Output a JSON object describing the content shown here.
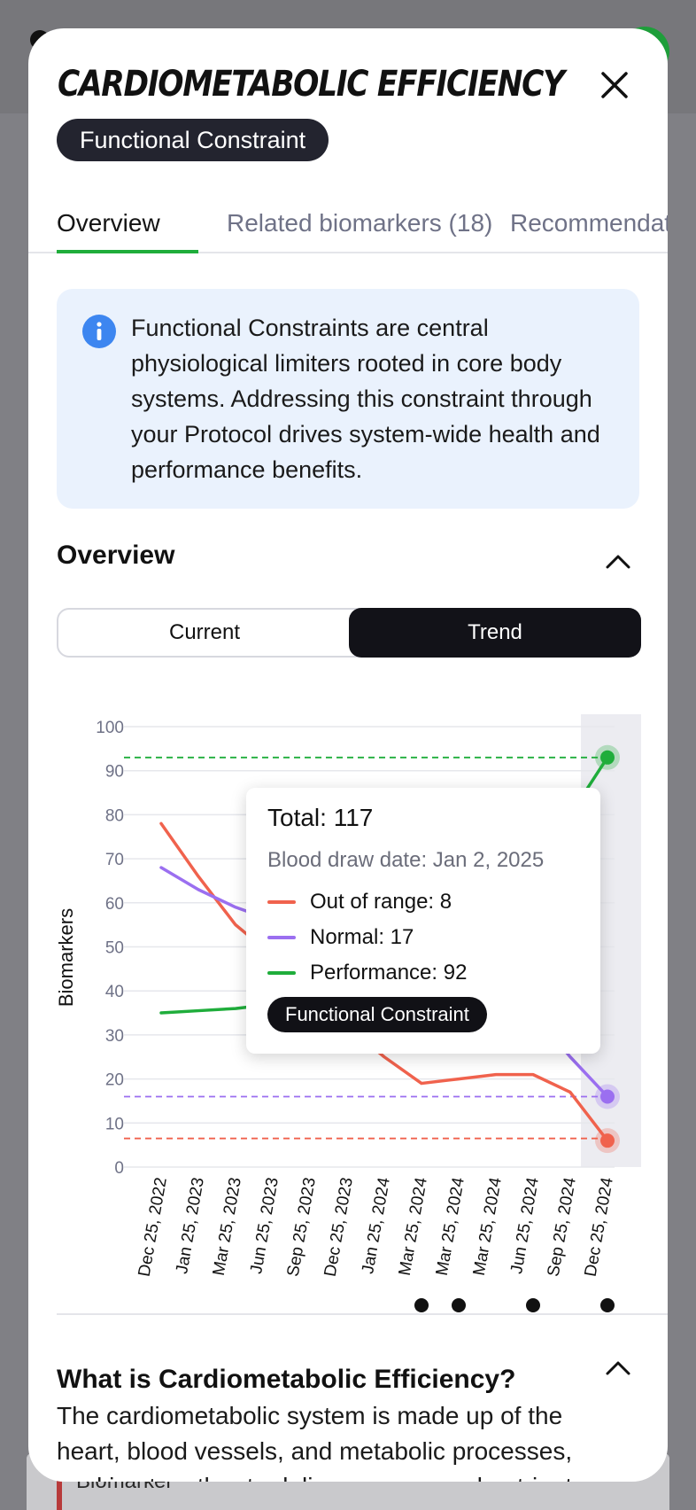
{
  "backdrop": {
    "card_label": "Biomarker"
  },
  "modal": {
    "title": "CARDIOMETABOLIC EFFICIENCY",
    "badge": "Functional Constraint",
    "tabs": [
      {
        "label": "Overview",
        "active": true
      },
      {
        "label": "Related biomarkers (18)",
        "active": false
      },
      {
        "label": "Recommendations",
        "active": false
      }
    ],
    "info_text": "Functional Constraints are central physiological limiters rooted in core body systems. Addressing this constraint through your Protocol drives system-wide health and performance benefits.",
    "overview": {
      "title": "Overview",
      "toggle": {
        "current_label": "Current",
        "trend_label": "Trend",
        "selected": "Trend"
      }
    },
    "tooltip": {
      "total": "Total: 117",
      "date": "Blood draw date: Jan 2, 2025",
      "out_of_range": "Out of range: 8",
      "normal": "Normal: 17",
      "performance": "Performance: 92",
      "badge": "Functional Constraint"
    },
    "what_is": {
      "title": "What is Cardiometabolic Efficiency?",
      "text": "The cardiometabolic system is made up of the heart, blood vessels, and metabolic processes, working together to deliver oxygen and nutrients"
    }
  },
  "colors": {
    "out_of_range": "#f0624d",
    "normal": "#9b6ff0",
    "performance": "#1fad3b",
    "accent": "#1fad3b",
    "dark": "#121218"
  },
  "chart_data": {
    "type": "line",
    "ylabel": "Biomarkers",
    "xlabel": "",
    "ylim": [
      0,
      100
    ],
    "yticks": [
      0,
      10,
      20,
      30,
      40,
      50,
      60,
      70,
      80,
      90,
      100
    ],
    "x": [
      "Dec 25, 2022",
      "Jan 25, 2023",
      "Mar 25, 2023",
      "Jun 25, 2023",
      "Sep 25, 2023",
      "Dec 25, 2023",
      "Jan 25, 2024",
      "Mar 25, 2024",
      "Mar 25, 2024",
      "Mar 25, 2024",
      "Jun 25, 2024",
      "Sep 25, 2024",
      "Dec 25, 2024"
    ],
    "blood_draw_markers": [
      7,
      8,
      10,
      12
    ],
    "highlighted_index": 12,
    "series": [
      {
        "name": "Out of range",
        "values": [
          78,
          66,
          55,
          48,
          40,
          32,
          25,
          19,
          20,
          21,
          21,
          17,
          6
        ],
        "reference": 6.5
      },
      {
        "name": "Normal",
        "values": [
          68,
          63,
          59,
          56,
          54,
          52,
          50,
          48,
          46,
          42,
          35,
          25,
          16
        ],
        "reference": 16
      },
      {
        "name": "Performance",
        "values": [
          35,
          35.5,
          36,
          37,
          38,
          39,
          40,
          42,
          45,
          50,
          60,
          80,
          93
        ],
        "reference": 93
      }
    ]
  }
}
